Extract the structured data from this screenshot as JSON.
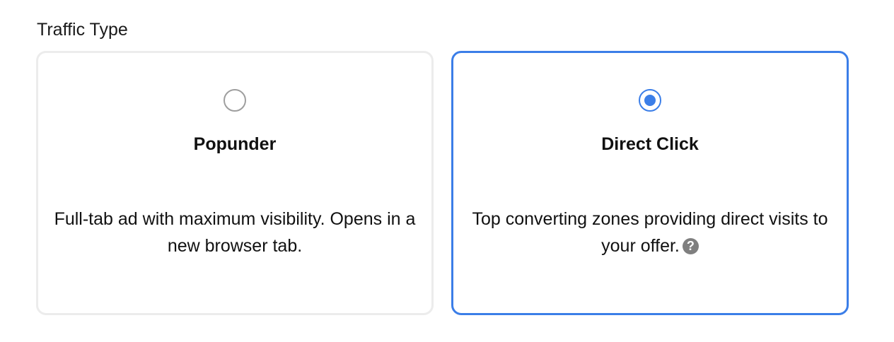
{
  "traffic_type": {
    "label": "Traffic Type",
    "selected": "Direct Click",
    "options": [
      {
        "title": "Popunder",
        "description": "Full-tab ad with maximum visibility. Opens in a new browser tab.",
        "selected": false
      },
      {
        "title": "Direct Click",
        "description": "Top converting zones providing direct visits to your offer.",
        "selected": true,
        "help_icon": "question-circle-icon",
        "help_glyph": "?"
      }
    ]
  },
  "colors": {
    "accent": "#3b7ee8",
    "unselected_border": "#ececec",
    "radio_off": "#9e9e9e",
    "help_icon_bg": "#7f7f7f"
  }
}
